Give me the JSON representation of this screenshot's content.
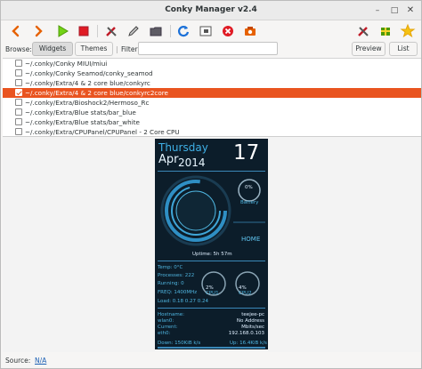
{
  "window": {
    "title": "Conky Manager v2.4"
  },
  "toolbar": {
    "left_icons": [
      "arrow-left-icon",
      "arrow-right-icon",
      "play-icon",
      "stop-icon",
      "tools-icon",
      "edit-icon",
      "folder-icon",
      "refresh-icon",
      "import-icon",
      "delete-icon",
      "camera-icon"
    ],
    "right_icons": [
      "settings-icon",
      "donate-icon",
      "about-icon"
    ]
  },
  "browse": {
    "label": "Browse:",
    "widgets_button": "Widgets",
    "themes_button": "Themes",
    "filter_label": "Filter",
    "filter_value": "",
    "preview_button": "Preview",
    "list_button": "List"
  },
  "items": [
    {
      "path": "~/.conky/Conky MIUI/miui",
      "checked": false,
      "selected": false
    },
    {
      "path": "~/.conky/Conky Seamod/conky_seamod",
      "checked": false,
      "selected": false
    },
    {
      "path": "~/.conky/Extra/4 & 2 core blue/conkyrc",
      "checked": false,
      "selected": false
    },
    {
      "path": "~/.conky/Extra/4 & 2 core blue/conkyrc2core",
      "checked": true,
      "selected": true
    },
    {
      "path": "~/.conky/Extra/Bioshock2/Hermoso_Rc",
      "checked": false,
      "selected": false
    },
    {
      "path": "~/.conky/Extra/Blue stats/bar_blue",
      "checked": false,
      "selected": false
    },
    {
      "path": "~/.conky/Extra/Blue stats/bar_white",
      "checked": false,
      "selected": false
    },
    {
      "path": "~/.conky/Extra/CPUPanel/CPUPanel - 2 Core CPU",
      "checked": false,
      "selected": false
    }
  ],
  "preview": {
    "day": "Thursday",
    "month": "Apr",
    "year": "2014",
    "date": "17",
    "battery_pct": "0%",
    "battery_label": "Battery",
    "home_label": "HOME",
    "uptime": "Uptime: 5h 57m",
    "temp": "Temp: 0°C",
    "processes": "Processes: 222",
    "running": "Running: 0",
    "freq": "FREQ: 1400MHz",
    "load": "Load: 0.18 0.27 0.24",
    "cpu1_pct": "2%",
    "cpu1_label": "CPU1",
    "cpu2_pct": "4%",
    "cpu2_label": "CPU2",
    "hostname_label": "Hostname:",
    "hostname_value": "teejee-pc",
    "wlan0_label": "wlan0:",
    "wlan0_value": "No Address",
    "current_label": "Current:",
    "current_value": "Mbits/sec",
    "eth0_label": "eth0:",
    "eth0_value": "192.168.0.103",
    "down": "Down: 150KiB k/s",
    "up": "Up: 16.4KiB k/s"
  },
  "status": {
    "label": "Source:",
    "link": "N/A"
  }
}
